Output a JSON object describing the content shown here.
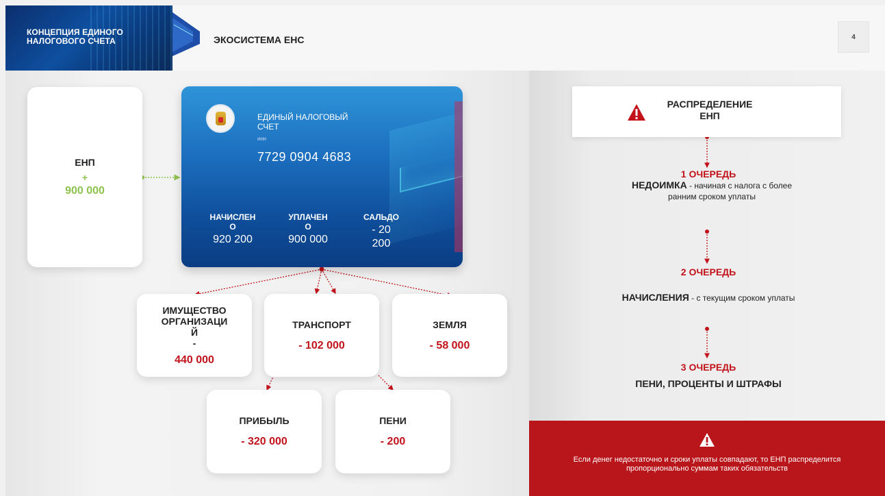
{
  "header": {
    "brand_title": "КОНЦЕПЦИЯ ЕДИНОГО\nНАЛОГОВОГО СЧЕТА",
    "section_title": "ЭКОСИСТЕМА ЕНС",
    "page_number": "4"
  },
  "enp": {
    "title": "ЕНП",
    "plus": "+",
    "value": "900 000"
  },
  "account_card": {
    "name": "ЕДИНЫЙ НАЛОГОВЫЙ\nСЧЕТ",
    "inn_label": "ИНН",
    "number": "7729 0904 4683",
    "columns": [
      {
        "label": "НАЧИСЛЕН\nО",
        "value": "920 200"
      },
      {
        "label": "УПЛАЧЕН\nО",
        "value": "900 000"
      },
      {
        "label": "САЛЬДО",
        "value": "- 20\n200"
      }
    ]
  },
  "taxes": [
    {
      "title": "ИМУЩЕСТВО\nОРГАНИЗАЦИ\nЙ\n-",
      "value": "440 000"
    },
    {
      "title": "ТРАНСПОРТ",
      "value": "- 102 000"
    },
    {
      "title": "ЗЕМЛЯ",
      "value": "- 58 000"
    },
    {
      "title": "ПРИБЫЛЬ",
      "value": "- 320 000"
    },
    {
      "title": "ПЕНИ",
      "value": "- 200"
    }
  ],
  "distribution": {
    "title": "РАСПРЕДЕЛЕНИЕ\nЕНП",
    "queue1_head": "1 ОЧЕРЕДЬ",
    "queue1_bold": "НЕДОИМКА",
    "queue1_text": " - начиная с налога с более ранним сроком уплаты",
    "queue2_head": "2 ОЧЕРЕДЬ",
    "queue2_bold": "НАЧИСЛЕНИЯ",
    "queue2_text": " - с текущим сроком уплаты",
    "queue3_head": "3 ОЧЕРЕДЬ",
    "queue3_text": "ПЕНИ, ПРОЦЕНТЫ И ШТРАФЫ"
  },
  "footer_note": "Если денег недостаточно и сроки уплаты совпадают, то ЕНП распределится пропорционально суммам таких обязательств",
  "colors": {
    "accent_red": "#c2131b",
    "accent_green": "#8fc34f",
    "card_blue": "#0f4f9c"
  }
}
